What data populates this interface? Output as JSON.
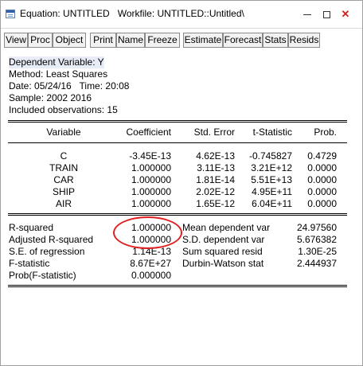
{
  "window": {
    "title": "Equation: UNTITLED   Workfile: UNTITLED::Untitled\\"
  },
  "toolbar": {
    "buttons": [
      "View",
      "Proc",
      "Object",
      "Print",
      "Name",
      "Freeze",
      "Estimate",
      "Forecast",
      "Stats",
      "Resids"
    ]
  },
  "header": {
    "lines": [
      "Dependent Variable: Y",
      "Method: Least Squares",
      "Date: 05/24/16   Time: 20:08",
      "Sample: 2002 2016",
      "Included observations: 15"
    ]
  },
  "table": {
    "headers": [
      "Variable",
      "Coefficient",
      "Std. Error",
      "t-Statistic",
      "Prob."
    ],
    "rows": [
      [
        "C",
        "-3.45E-13",
        "4.62E-13",
        "-0.745827",
        "0.4729"
      ],
      [
        "TRAIN",
        "1.000000",
        "3.11E-13",
        "3.21E+12",
        "0.0000"
      ],
      [
        "CAR",
        "1.000000",
        "1.81E-14",
        "5.51E+13",
        "0.0000"
      ],
      [
        "SHIP",
        "1.000000",
        "2.02E-12",
        "4.95E+11",
        "0.0000"
      ],
      [
        "AIR",
        "1.000000",
        "1.65E-12",
        "6.04E+11",
        "0.0000"
      ]
    ]
  },
  "stats": {
    "left": [
      [
        "R-squared",
        "1.000000"
      ],
      [
        "Adjusted R-squared",
        "1.000000"
      ],
      [
        "S.E. of regression",
        "1.14E-13"
      ],
      [
        "F-statistic",
        "8.67E+27"
      ],
      [
        "Prob(F-statistic)",
        "0.000000"
      ]
    ],
    "right": [
      [
        "Mean dependent var",
        "24.97560"
      ],
      [
        "S.D. dependent var",
        "5.676382"
      ],
      [
        "Sum squared resid",
        "1.30E-25"
      ],
      [
        "Durbin-Watson stat",
        "2.444937"
      ]
    ]
  },
  "annotation_color": "#e02020"
}
